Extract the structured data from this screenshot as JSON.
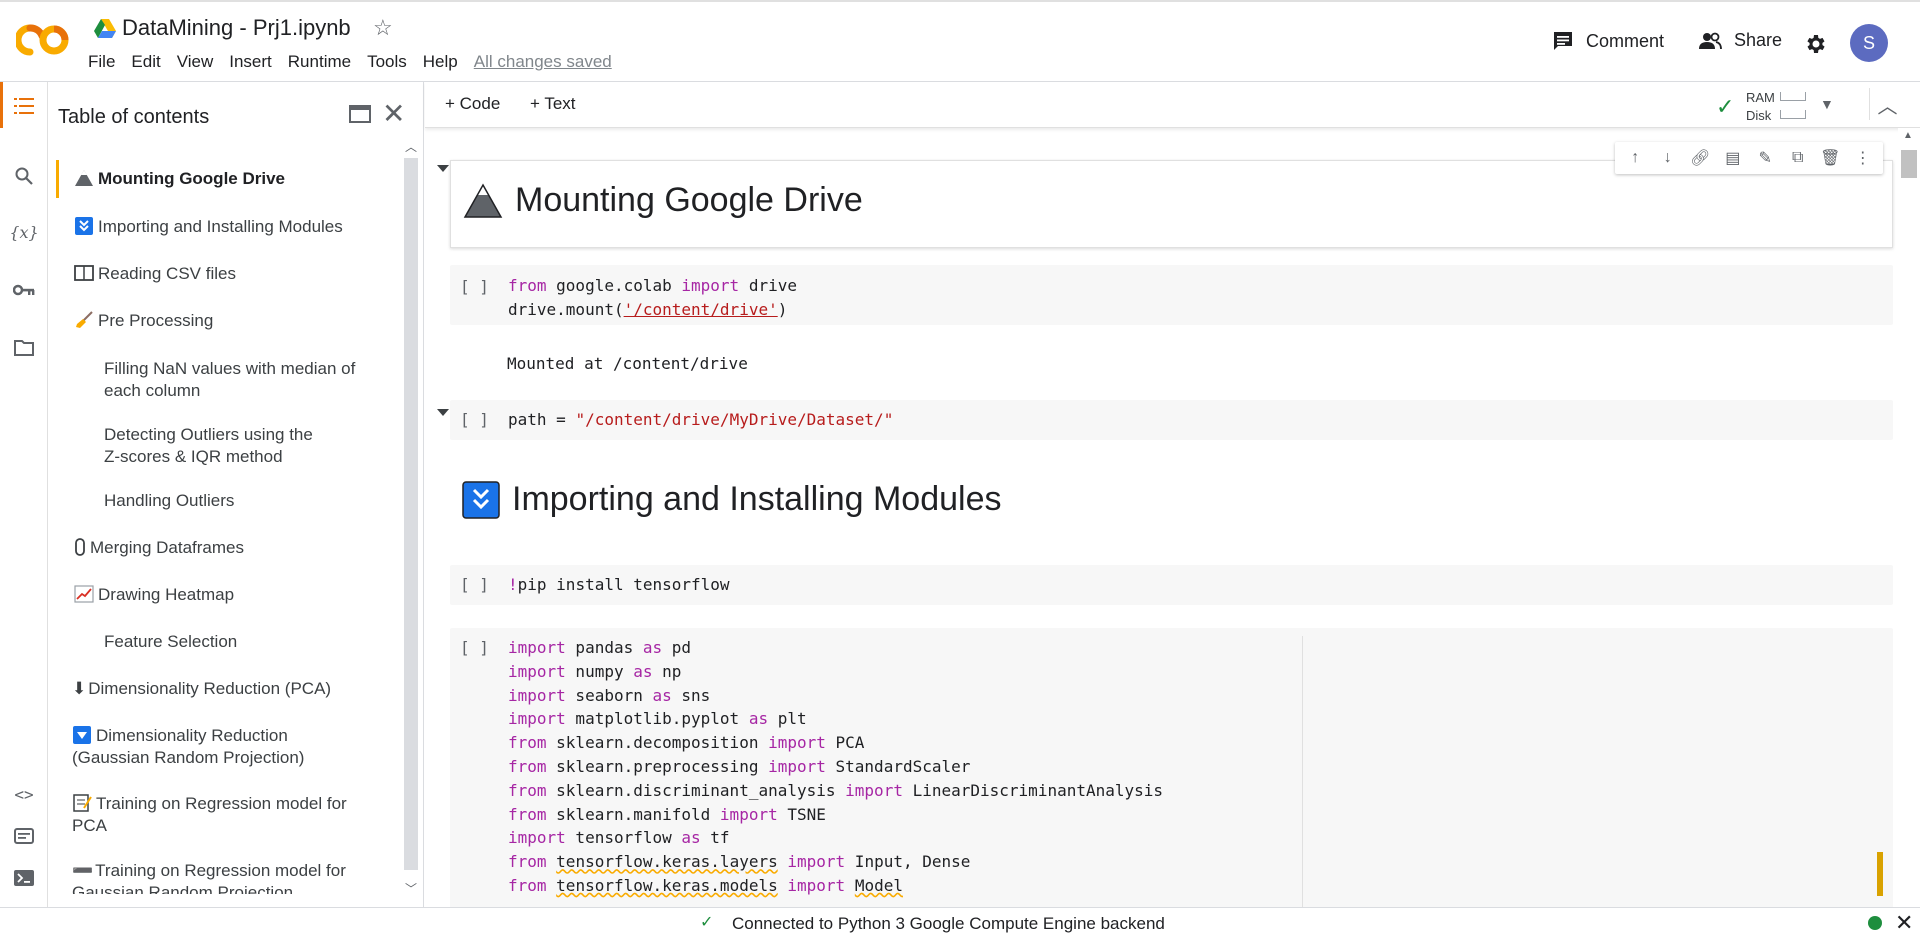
{
  "app": {
    "title": "DataMining - Prj1.ipynb",
    "menu": [
      "File",
      "Edit",
      "View",
      "Insert",
      "Runtime",
      "Tools",
      "Help"
    ],
    "saved_status": "All changes saved",
    "comment_label": "Comment",
    "share_label": "Share",
    "avatar_letter": "S"
  },
  "toolbar": {
    "add_code": "+ Code",
    "add_text": "+ Text",
    "ram_label": "RAM",
    "disk_label": "Disk"
  },
  "toc": {
    "title": "Table of contents",
    "items": [
      {
        "label": "Mounting Google Drive",
        "icon": "mountain"
      },
      {
        "label": "Importing and Installing Modules",
        "icon": "down-arrow-box"
      },
      {
        "label": "Reading CSV files",
        "icon": "book"
      },
      {
        "label": "Pre Processing",
        "icon": "broom"
      },
      {
        "label": "Filling NaN values with median of",
        "label2": "each column",
        "icon": ""
      },
      {
        "label": "Detecting Outliers using the",
        "label2": "Z-scores & IQR method",
        "icon": ""
      },
      {
        "label": "Handling Outliers",
        "icon": ""
      },
      {
        "label": "Merging Dataframes",
        "icon": "paperclip"
      },
      {
        "label": "Drawing Heatmap",
        "icon": "chart"
      },
      {
        "label": "Feature Selection",
        "icon": ""
      },
      {
        "label": "Dimensionality Reduction (PCA)",
        "icon": "down-arrow"
      },
      {
        "label": "Dimensionality Reduction",
        "label2": "(Gaussian Random Projection)",
        "icon": "down-triangle-box"
      },
      {
        "label": "Training on Regression model for",
        "label2": "PCA",
        "icon": "memo"
      },
      {
        "label": "Training on Regression model for",
        "label2": "Gaussian Random Projection",
        "icon": "minus"
      }
    ]
  },
  "notebook": {
    "heading1": "Mounting Google Drive",
    "heading2": "Importing and Installing Modules",
    "run_bracket": "[ ]",
    "cell1_line1_a": "from",
    "cell1_line1_b": " google.colab ",
    "cell1_line1_c": "import",
    "cell1_line1_d": " drive",
    "cell1_line2_a": "drive.mount(",
    "cell1_line2_b": "'/content/drive'",
    "cell1_line2_c": ")",
    "cell1_output": "Mounted at /content/drive",
    "cell2_a": "path = ",
    "cell2_b": "\"/content/drive/MyDrive/Dataset/\"",
    "cell3_a": "!",
    "cell3_b": "pip install tensorflow",
    "imports": [
      [
        "import",
        " pandas ",
        "as",
        " pd"
      ],
      [
        "import",
        " numpy ",
        "as",
        " np"
      ],
      [
        "import",
        " seaborn ",
        "as",
        " sns"
      ],
      [
        "import",
        " matplotlib.pyplot ",
        "as",
        " plt"
      ],
      [
        "from",
        " sklearn.decomposition ",
        "import",
        " PCA"
      ],
      [
        "from",
        " sklearn.preprocessing ",
        "import",
        " StandardScaler"
      ],
      [
        "from",
        " sklearn.discriminant_analysis ",
        "import",
        " LinearDiscriminantAnalysis"
      ],
      [
        "from",
        " sklearn.manifold ",
        "import",
        " TSNE"
      ],
      [
        "import",
        " tensorflow ",
        "as",
        " tf"
      ],
      [
        "from",
        " tensorflow.keras.layers ",
        "import",
        " Input, Dense"
      ],
      [
        "from",
        " tensorflow.keras.models ",
        "import",
        " Model"
      ]
    ]
  },
  "status": {
    "text": "Connected to Python 3 Google Compute Engine backend"
  }
}
